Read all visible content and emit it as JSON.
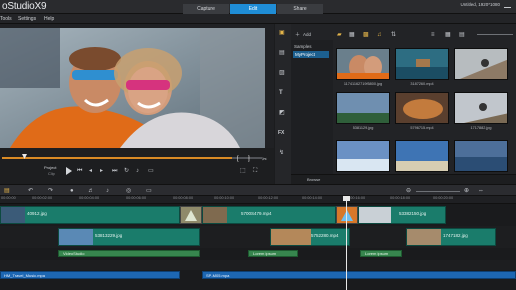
{
  "app": {
    "logo": "oStudioX9",
    "res_info": "Untitled, 1920*1080",
    "tabs": [
      {
        "label": "Capture",
        "active": false
      },
      {
        "label": "Edit",
        "active": true
      },
      {
        "label": "Share",
        "active": false
      }
    ]
  },
  "menu": [
    "Tools",
    "Settings",
    "Help"
  ],
  "preview": {
    "mode_label": "Project",
    "mode_label2": "Clip",
    "progress": 0.88
  },
  "library": {
    "folders_header": "Samples",
    "folder_selected": "MyProject",
    "add_label": "Add",
    "browse_label": "Browse",
    "thumbs": [
      {
        "label": "11741162719f5800.jpg",
        "color": "#8a6a4f"
      },
      {
        "label": "3187260.mp4",
        "color": "#2d6d82"
      },
      {
        "label": "",
        "color": "#b7bcbf"
      },
      {
        "label": "5381129.jpg",
        "color": "#6f8fb0"
      },
      {
        "label": "5796715.mp4",
        "color": "#5a3f2e"
      },
      {
        "label": "1717882.jpg",
        "color": "#c1c6cc"
      },
      {
        "label": "",
        "color": "#6b91c4"
      },
      {
        "label": "",
        "color": "#3e74b4"
      },
      {
        "label": "",
        "color": "#4d6f9a"
      }
    ]
  },
  "timeline": {
    "ruler": [
      "00:00:00",
      "00:00:02:00",
      "00:00:04:00",
      "00:00:06:00",
      "00:00:08:00",
      "00:00:10:00",
      "00:00:12:00",
      "00:00:14:00",
      "00:00:16:00",
      "00:00:18:00",
      "00:00:20:00"
    ],
    "video_clips": [
      "40912.jpg",
      "5700S479.mp4",
      "53382150.jpg"
    ],
    "overlay_clips": [
      "53813229.jpg",
      "5752280.mp4",
      "1747182.jpg"
    ],
    "title_clips": [
      "VideoStudio",
      "Lorem ipsum",
      "Lorem ipsum"
    ],
    "audio_clips": [
      "HM_Travel_Music.mpa",
      "SP-M05.mpa"
    ]
  },
  "colors": {
    "accent": "#1f8dd6",
    "orange": "#d98a25",
    "clip": "#1a7c6b",
    "audio": "#1d67b3",
    "title": "#37864e"
  }
}
